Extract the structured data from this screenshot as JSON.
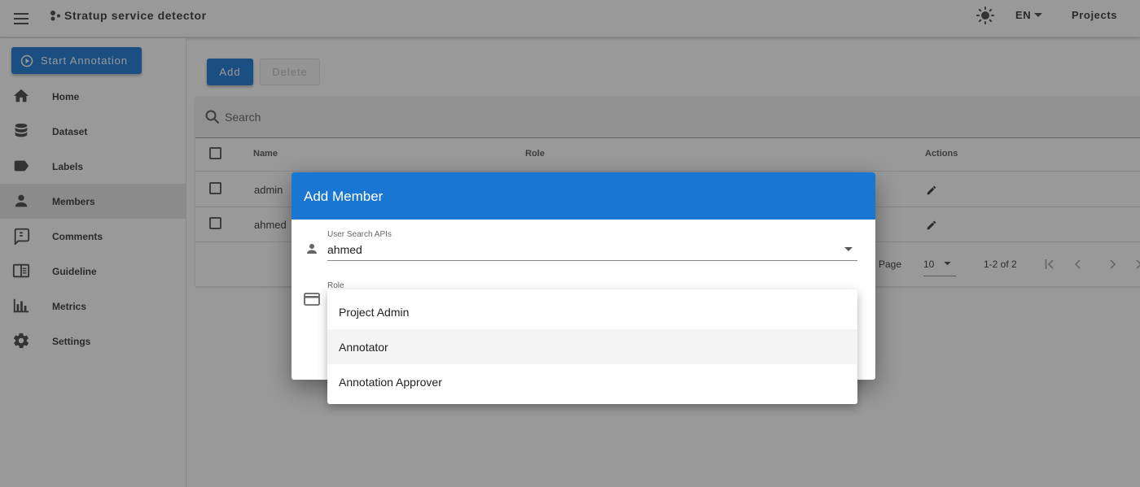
{
  "appbar": {
    "title": "Stratup service detector",
    "language": "EN",
    "projects_label": "Projects"
  },
  "sidebar": {
    "start_label": "Start Annotation",
    "items": [
      {
        "label": "Home",
        "icon": "home-icon"
      },
      {
        "label": "Dataset",
        "icon": "database-icon"
      },
      {
        "label": "Labels",
        "icon": "label-icon"
      },
      {
        "label": "Members",
        "icon": "person-icon",
        "active": true
      },
      {
        "label": "Comments",
        "icon": "comment-icon"
      },
      {
        "label": "Guideline",
        "icon": "book-icon"
      },
      {
        "label": "Metrics",
        "icon": "chart-icon"
      },
      {
        "label": "Settings",
        "icon": "gear-icon"
      }
    ]
  },
  "toolbar": {
    "add_label": "Add",
    "delete_label": "Delete"
  },
  "search": {
    "placeholder": "Search"
  },
  "table": {
    "headers": {
      "name": "Name",
      "role": "Role",
      "actions": "Actions"
    },
    "rows": [
      {
        "name": "admin"
      },
      {
        "name": "ahmed"
      }
    ],
    "pager": {
      "rows_label": "Page",
      "per_page": "10",
      "range": "1-2 of 2"
    }
  },
  "dialog": {
    "title": "Add Member",
    "user_field_label": "User Search APIs",
    "user_field_value": "ahmed",
    "role_field_label": "Role"
  },
  "role_menu": {
    "options": [
      "Project Admin",
      "Annotator",
      "Annotation Approver"
    ],
    "highlighted_index": 1
  },
  "colors": {
    "primary": "#1976d2"
  }
}
